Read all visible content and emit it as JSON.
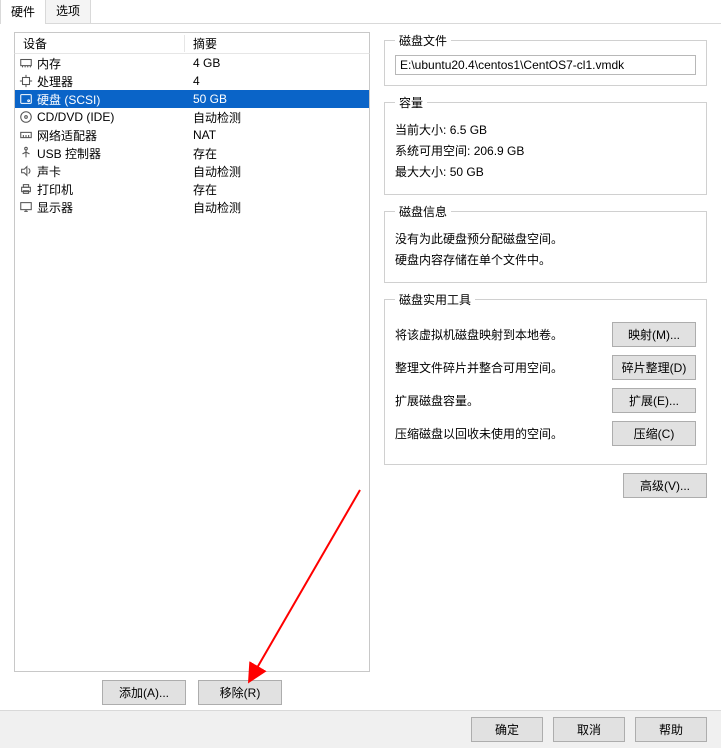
{
  "tabs": {
    "hardware": "硬件",
    "options": "选项"
  },
  "headers": {
    "device": "设备",
    "summary": "摘要"
  },
  "devices": [
    {
      "name": "内存",
      "summary": "4 GB",
      "icon": "memory"
    },
    {
      "name": "处理器",
      "summary": "4",
      "icon": "cpu"
    },
    {
      "name": "硬盘 (SCSI)",
      "summary": "50 GB",
      "icon": "disk",
      "selected": true
    },
    {
      "name": "CD/DVD (IDE)",
      "summary": "自动检测",
      "icon": "cd"
    },
    {
      "name": "网络适配器",
      "summary": "NAT",
      "icon": "net"
    },
    {
      "name": "USB 控制器",
      "summary": "存在",
      "icon": "usb"
    },
    {
      "name": "声卡",
      "summary": "自动检测",
      "icon": "sound"
    },
    {
      "name": "打印机",
      "summary": "存在",
      "icon": "printer"
    },
    {
      "name": "显示器",
      "summary": "自动检测",
      "icon": "display"
    }
  ],
  "leftButtons": {
    "add": "添加(A)...",
    "remove": "移除(R)"
  },
  "diskFile": {
    "legend": "磁盘文件",
    "value": "E:\\ubuntu20.4\\centos1\\CentOS7-cl1.vmdk"
  },
  "capacity": {
    "legend": "容量",
    "current_label": "当前大小:",
    "current_value": "6.5 GB",
    "free_label": "系统可用空间:",
    "free_value": "206.9 GB",
    "max_label": "最大大小:",
    "max_value": "50 GB"
  },
  "diskInfo": {
    "legend": "磁盘信息",
    "line1": "没有为此硬盘预分配磁盘空间。",
    "line2": "硬盘内容存储在单个文件中。"
  },
  "utilities": {
    "legend": "磁盘实用工具",
    "map_desc": "将该虚拟机磁盘映射到本地卷。",
    "map_btn": "映射(M)...",
    "defrag_desc": "整理文件碎片并整合可用空间。",
    "defrag_btn": "碎片整理(D)",
    "expand_desc": "扩展磁盘容量。",
    "expand_btn": "扩展(E)...",
    "shrink_desc": "压缩磁盘以回收未使用的空间。",
    "shrink_btn": "压缩(C)"
  },
  "advanced_btn": "高级(V)...",
  "footer": {
    "ok": "确定",
    "cancel": "取消",
    "help": "帮助"
  }
}
